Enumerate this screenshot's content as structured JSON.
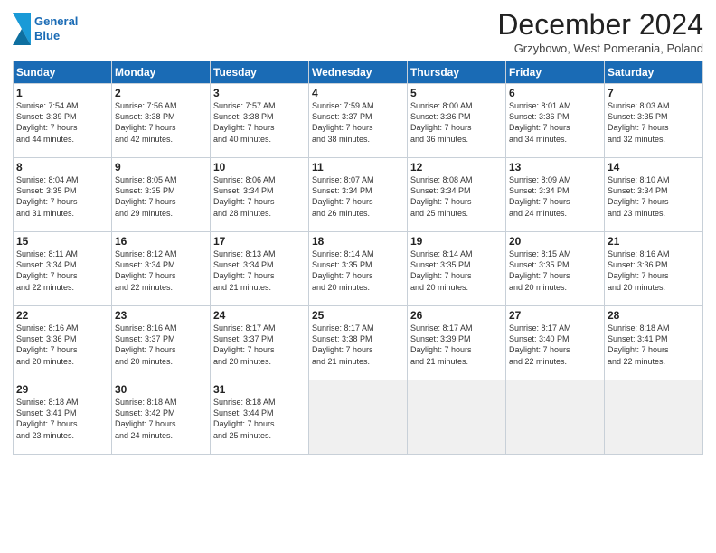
{
  "header": {
    "logo_line1": "General",
    "logo_line2": "Blue",
    "title": "December 2024",
    "location": "Grzybowo, West Pomerania, Poland"
  },
  "weekdays": [
    "Sunday",
    "Monday",
    "Tuesday",
    "Wednesday",
    "Thursday",
    "Friday",
    "Saturday"
  ],
  "days": [
    {
      "num": "",
      "info": ""
    },
    {
      "num": "",
      "info": ""
    },
    {
      "num": "",
      "info": ""
    },
    {
      "num": "",
      "info": ""
    },
    {
      "num": "",
      "info": ""
    },
    {
      "num": "",
      "info": ""
    },
    {
      "num": "1",
      "info": "Sunrise: 7:54 AM\nSunset: 3:39 PM\nDaylight: 7 hours\nand 44 minutes."
    },
    {
      "num": "2",
      "info": "Sunrise: 7:56 AM\nSunset: 3:38 PM\nDaylight: 7 hours\nand 42 minutes."
    },
    {
      "num": "3",
      "info": "Sunrise: 7:57 AM\nSunset: 3:38 PM\nDaylight: 7 hours\nand 40 minutes."
    },
    {
      "num": "4",
      "info": "Sunrise: 7:59 AM\nSunset: 3:37 PM\nDaylight: 7 hours\nand 38 minutes."
    },
    {
      "num": "5",
      "info": "Sunrise: 8:00 AM\nSunset: 3:36 PM\nDaylight: 7 hours\nand 36 minutes."
    },
    {
      "num": "6",
      "info": "Sunrise: 8:01 AM\nSunset: 3:36 PM\nDaylight: 7 hours\nand 34 minutes."
    },
    {
      "num": "7",
      "info": "Sunrise: 8:03 AM\nSunset: 3:35 PM\nDaylight: 7 hours\nand 32 minutes."
    },
    {
      "num": "8",
      "info": "Sunrise: 8:04 AM\nSunset: 3:35 PM\nDaylight: 7 hours\nand 31 minutes."
    },
    {
      "num": "9",
      "info": "Sunrise: 8:05 AM\nSunset: 3:35 PM\nDaylight: 7 hours\nand 29 minutes."
    },
    {
      "num": "10",
      "info": "Sunrise: 8:06 AM\nSunset: 3:34 PM\nDaylight: 7 hours\nand 28 minutes."
    },
    {
      "num": "11",
      "info": "Sunrise: 8:07 AM\nSunset: 3:34 PM\nDaylight: 7 hours\nand 26 minutes."
    },
    {
      "num": "12",
      "info": "Sunrise: 8:08 AM\nSunset: 3:34 PM\nDaylight: 7 hours\nand 25 minutes."
    },
    {
      "num": "13",
      "info": "Sunrise: 8:09 AM\nSunset: 3:34 PM\nDaylight: 7 hours\nand 24 minutes."
    },
    {
      "num": "14",
      "info": "Sunrise: 8:10 AM\nSunset: 3:34 PM\nDaylight: 7 hours\nand 23 minutes."
    },
    {
      "num": "15",
      "info": "Sunrise: 8:11 AM\nSunset: 3:34 PM\nDaylight: 7 hours\nand 22 minutes."
    },
    {
      "num": "16",
      "info": "Sunrise: 8:12 AM\nSunset: 3:34 PM\nDaylight: 7 hours\nand 22 minutes."
    },
    {
      "num": "17",
      "info": "Sunrise: 8:13 AM\nSunset: 3:34 PM\nDaylight: 7 hours\nand 21 minutes."
    },
    {
      "num": "18",
      "info": "Sunrise: 8:14 AM\nSunset: 3:35 PM\nDaylight: 7 hours\nand 20 minutes."
    },
    {
      "num": "19",
      "info": "Sunrise: 8:14 AM\nSunset: 3:35 PM\nDaylight: 7 hours\nand 20 minutes."
    },
    {
      "num": "20",
      "info": "Sunrise: 8:15 AM\nSunset: 3:35 PM\nDaylight: 7 hours\nand 20 minutes."
    },
    {
      "num": "21",
      "info": "Sunrise: 8:16 AM\nSunset: 3:36 PM\nDaylight: 7 hours\nand 20 minutes."
    },
    {
      "num": "22",
      "info": "Sunrise: 8:16 AM\nSunset: 3:36 PM\nDaylight: 7 hours\nand 20 minutes."
    },
    {
      "num": "23",
      "info": "Sunrise: 8:16 AM\nSunset: 3:37 PM\nDaylight: 7 hours\nand 20 minutes."
    },
    {
      "num": "24",
      "info": "Sunrise: 8:17 AM\nSunset: 3:37 PM\nDaylight: 7 hours\nand 20 minutes."
    },
    {
      "num": "25",
      "info": "Sunrise: 8:17 AM\nSunset: 3:38 PM\nDaylight: 7 hours\nand 21 minutes."
    },
    {
      "num": "26",
      "info": "Sunrise: 8:17 AM\nSunset: 3:39 PM\nDaylight: 7 hours\nand 21 minutes."
    },
    {
      "num": "27",
      "info": "Sunrise: 8:17 AM\nSunset: 3:40 PM\nDaylight: 7 hours\nand 22 minutes."
    },
    {
      "num": "28",
      "info": "Sunrise: 8:18 AM\nSunset: 3:41 PM\nDaylight: 7 hours\nand 22 minutes."
    },
    {
      "num": "29",
      "info": "Sunrise: 8:18 AM\nSunset: 3:41 PM\nDaylight: 7 hours\nand 23 minutes."
    },
    {
      "num": "30",
      "info": "Sunrise: 8:18 AM\nSunset: 3:42 PM\nDaylight: 7 hours\nand 24 minutes."
    },
    {
      "num": "31",
      "info": "Sunrise: 8:18 AM\nSunset: 3:44 PM\nDaylight: 7 hours\nand 25 minutes."
    },
    {
      "num": "",
      "info": ""
    },
    {
      "num": "",
      "info": ""
    },
    {
      "num": "",
      "info": ""
    },
    {
      "num": "",
      "info": ""
    }
  ]
}
